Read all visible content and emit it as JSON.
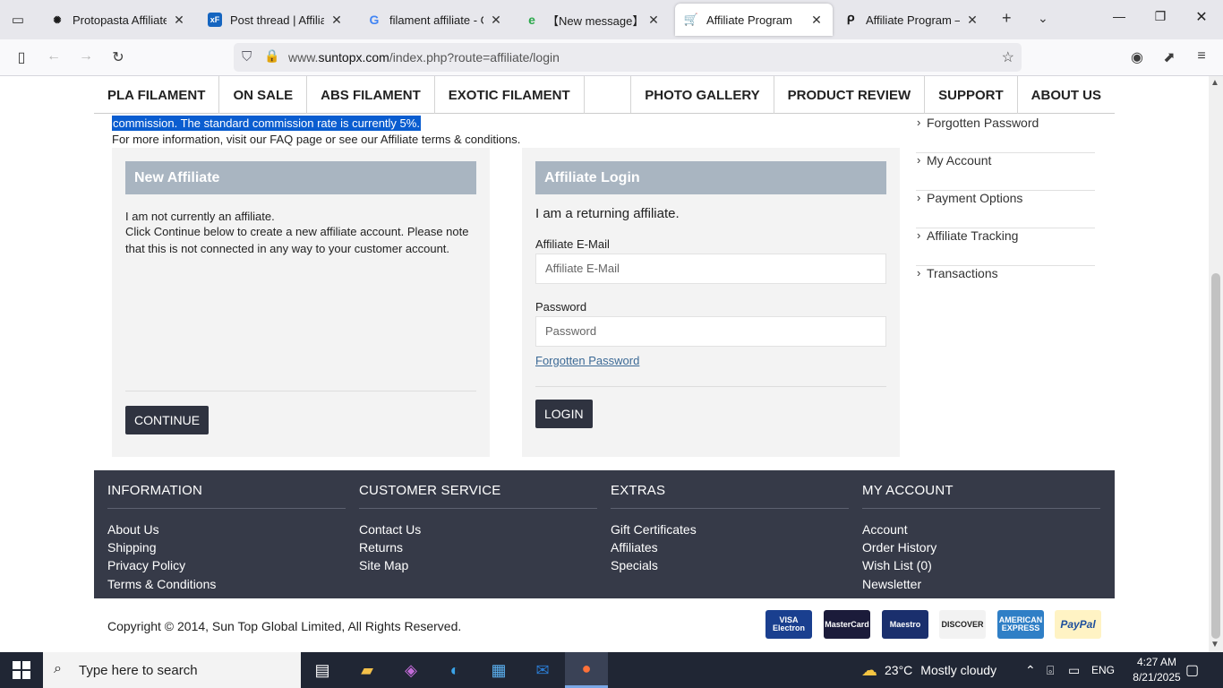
{
  "browser": {
    "tabs": [
      {
        "title": "Protopasta Affiliate Pro",
        "icon": "openai-icon"
      },
      {
        "title": "Post thread | Affiliate W",
        "icon": "xenforo-icon"
      },
      {
        "title": "filament affiliate - Goo",
        "icon": "google-icon"
      },
      {
        "title": "【New message】Affil",
        "icon": "edge-like-icon"
      },
      {
        "title": "Affiliate Program",
        "icon": "cart-icon"
      },
      {
        "title": "Affiliate Program – Pro",
        "icon": "pinterest-like-icon"
      }
    ],
    "active_tab_index": 4,
    "url_prefix": "www.",
    "url_domain": "suntopx.com",
    "url_path": "/index.php?route=affiliate/login"
  },
  "menu": {
    "items": [
      "PLA FILAMENT",
      "ON SALE",
      "ABS FILAMENT",
      "EXOTIC FILAMENT",
      "PHOTO GALLERY",
      "PRODUCT REVIEW",
      "SUPPORT",
      "ABOUT US"
    ]
  },
  "intro": {
    "selected_text": "commission. The standard commission rate is currently 5%.",
    "info_text": "For more information, visit our FAQ page or see our Affiliate terms & conditions."
  },
  "new_affiliate": {
    "heading": "New Affiliate",
    "line1": "I am not currently an affiliate.",
    "line2": "Click Continue below to create a new affiliate account. Please note",
    "line3": "that this is not connected in any way to your customer account.",
    "button": "CONTINUE"
  },
  "login": {
    "heading": "Affiliate Login",
    "subheading": "I am a returning affiliate.",
    "email_label": "Affiliate E-Mail",
    "email_placeholder": "Affiliate E-Mail",
    "password_label": "Password",
    "password_placeholder": "Password",
    "forgot_link": "Forgotten Password",
    "button": "LOGIN"
  },
  "sidebar": {
    "items": [
      "Forgotten Password",
      "My Account",
      "Payment Options",
      "Affiliate Tracking",
      "Transactions"
    ]
  },
  "footer": {
    "columns": [
      {
        "title": "INFORMATION",
        "links": [
          "About Us",
          "Shipping",
          "Privacy Policy",
          "Terms & Conditions"
        ]
      },
      {
        "title": "CUSTOMER SERVICE",
        "links": [
          "Contact Us",
          "Returns",
          "Site Map"
        ]
      },
      {
        "title": "EXTRAS",
        "links": [
          "Gift Certificates",
          "Affiliates",
          "Specials"
        ]
      },
      {
        "title": "MY ACCOUNT",
        "links": [
          "Account",
          "Order History",
          "Wish List (0)",
          "Newsletter"
        ]
      }
    ],
    "copyright": "Copyright © 2014, Sun Top Global Limited, All Rights Reserved.",
    "payment_cards": [
      {
        "label": "VISA Electron",
        "bg": "#1a3f8f",
        "fg": "#ffffff"
      },
      {
        "label": "MasterCard",
        "bg": "#1b1b3a",
        "fg": "#ffffff"
      },
      {
        "label": "Maestro",
        "bg": "#1a2f6d",
        "fg": "#ffffff"
      },
      {
        "label": "DISCOVER",
        "bg": "#f2f2f2",
        "fg": "#222222"
      },
      {
        "label": "AMERICAN EXPRESS",
        "bg": "#2f7fc6",
        "fg": "#ffffff"
      },
      {
        "label": "PayPal",
        "bg": "#fff3c4",
        "fg": "#1d4f9c"
      }
    ]
  },
  "taskbar": {
    "search_placeholder": "Type here to search",
    "weather_temp": "23°C",
    "weather_text": "Mostly cloudy",
    "language": "ENG",
    "time": "4:27 AM",
    "date": "8/21/2025"
  },
  "colors": {
    "panel_header": "#a9b5c1",
    "footer_bg": "#363a48",
    "dark_button": "#2f3340",
    "selection": "#0a5dd0",
    "link": "#3c6a96"
  }
}
